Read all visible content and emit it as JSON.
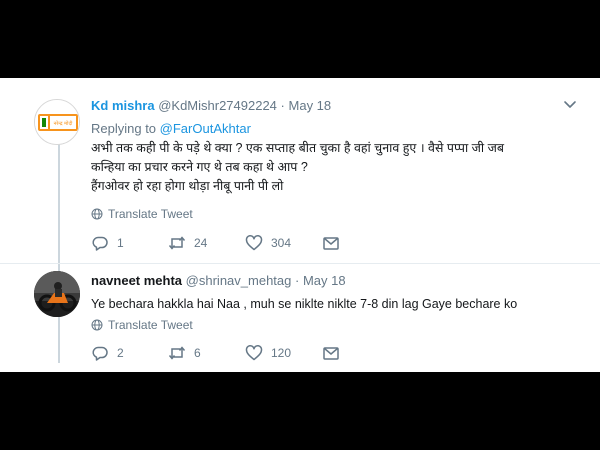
{
  "colors": {
    "link": "#1b95e0",
    "muted": "#657786",
    "text": "#14171a"
  },
  "tweets": [
    {
      "name": "Kd mishra",
      "handle": "@KdMishr27492224",
      "dot": "·",
      "date": "May 18",
      "replying_prefix": "Replying to",
      "replying_to": "@FarOutAkhtar",
      "lines": [
        "अभी तक कही पी के पड़े थे क्या ? एक सप्ताह बीत चुका है वहां चुनाव हुए । वैसे पप्पा जी जब",
        "कन्हिया का प्रचार करने गए थे तब कहा थे आप ?",
        "हैंगओवर हो रहा होगा थोड़ा नीबू पानी पी लो"
      ],
      "avatar_text": "नरेन्द्र मोदी",
      "translate": "Translate Tweet",
      "replies": "1",
      "retweets": "24",
      "likes": "304",
      "icons": [
        "chevron-down-icon",
        "globe-icon",
        "reply-icon",
        "retweet-icon",
        "heart-icon",
        "message-icon"
      ]
    },
    {
      "name": "navneet mehta",
      "handle": "@shrinav_mehtag",
      "dot": "·",
      "date": "May 18",
      "lines": [
        "Ye bechara hakkla hai Naa , muh se niklte niklte 7-8 din lag Gaye bechare ko"
      ],
      "translate": "Translate Tweet",
      "replies": "2",
      "retweets": "6",
      "likes": "120",
      "icons": [
        "globe-icon",
        "reply-icon",
        "retweet-icon",
        "heart-icon",
        "message-icon"
      ]
    }
  ]
}
